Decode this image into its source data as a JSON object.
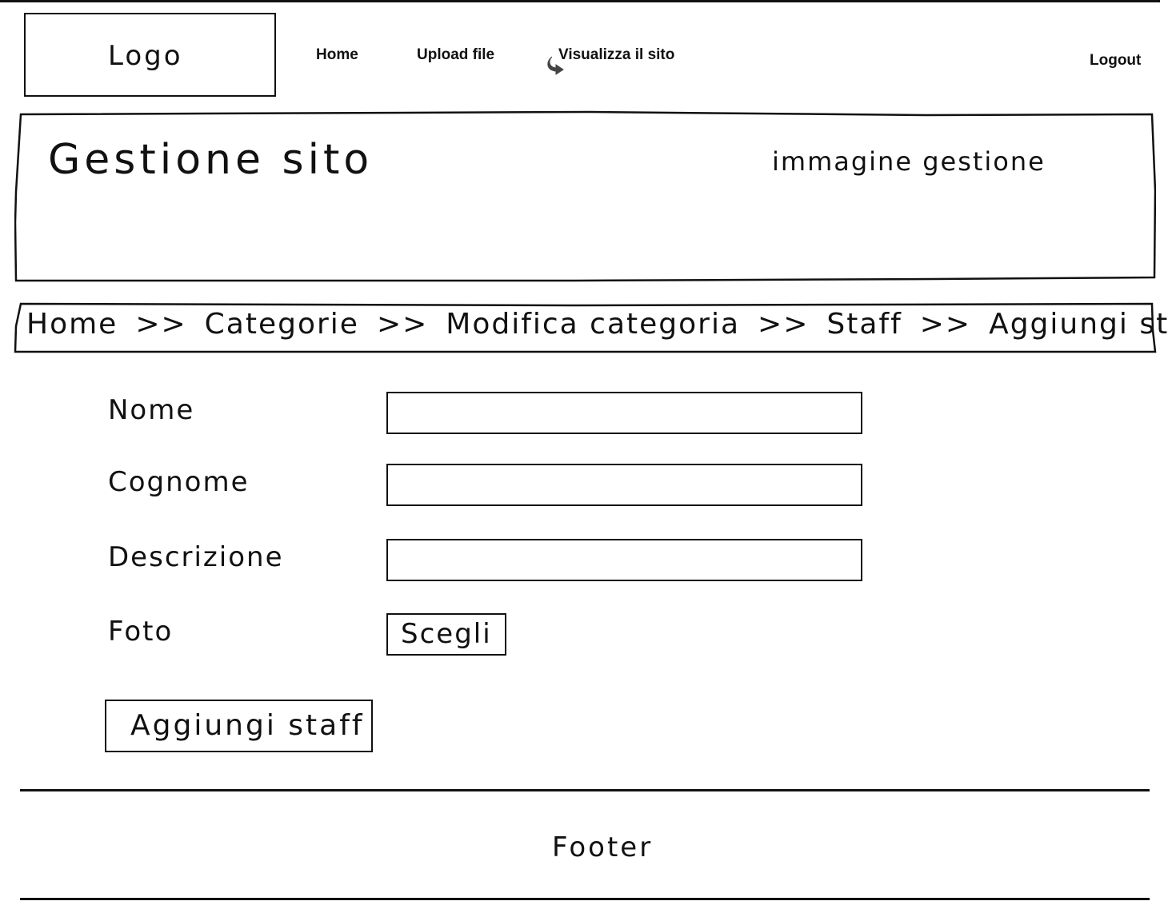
{
  "logo": {
    "label": "Logo"
  },
  "nav": {
    "items": [
      {
        "label": "Home"
      },
      {
        "label": "Upload file"
      },
      {
        "label": "Visualizza il sito",
        "icon": "external-link-arrow-icon"
      }
    ],
    "logout_label": "Logout"
  },
  "header": {
    "title": "Gestione sito",
    "image_placeholder": "immagine gestione"
  },
  "breadcrumb": {
    "items": [
      "Home",
      "Categorie",
      "Modifica categoria",
      "Staff",
      "Aggiungi staff"
    ],
    "separator": ">>"
  },
  "form": {
    "fields": [
      {
        "label": "Nome",
        "value": ""
      },
      {
        "label": "Cognome",
        "value": ""
      },
      {
        "label": "Descrizione",
        "value": ""
      },
      {
        "label": "Foto"
      }
    ],
    "choose_button_label": "Scegli",
    "submit_label": "Aggiungi staff"
  },
  "footer": {
    "label": "Footer"
  }
}
